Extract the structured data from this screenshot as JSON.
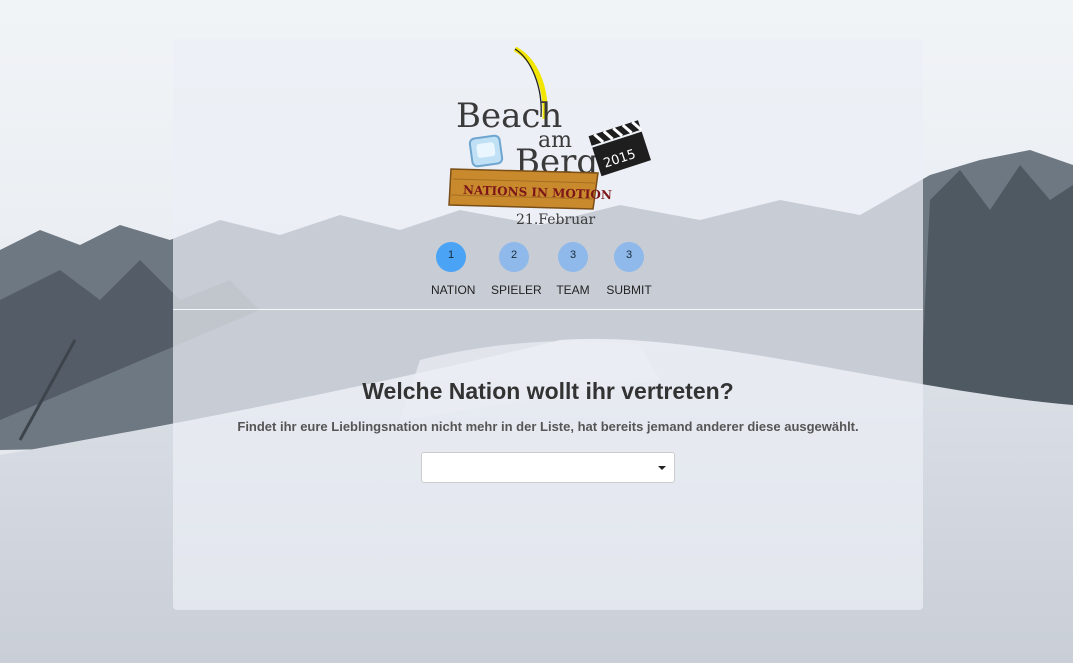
{
  "logo": {
    "line1": "Beach",
    "line2a": "am",
    "line2b": "Berg",
    "banner": "NATIONS IN MOTION",
    "date": "21.Februar",
    "year": "2015"
  },
  "steps": [
    {
      "number": "1",
      "label": "NATION",
      "active": true
    },
    {
      "number": "2",
      "label": "SPIELER",
      "active": false
    },
    {
      "number": "3",
      "label": "TEAM",
      "active": false
    },
    {
      "number": "3",
      "label": "SUBMIT",
      "active": false
    }
  ],
  "form": {
    "heading": "Welche Nation wollt ihr vertreten?",
    "subtext": "Findet ihr eure Lieblingsnation nicht mehr in der Liste, hat bereits jemand anderer diese ausgewählt.",
    "nation_select": {
      "value": ""
    }
  },
  "colors": {
    "active_step": "#4aa3f5",
    "inactive_step": "#8fb9ea",
    "panel": "rgba(236,239,245,0.72)"
  }
}
